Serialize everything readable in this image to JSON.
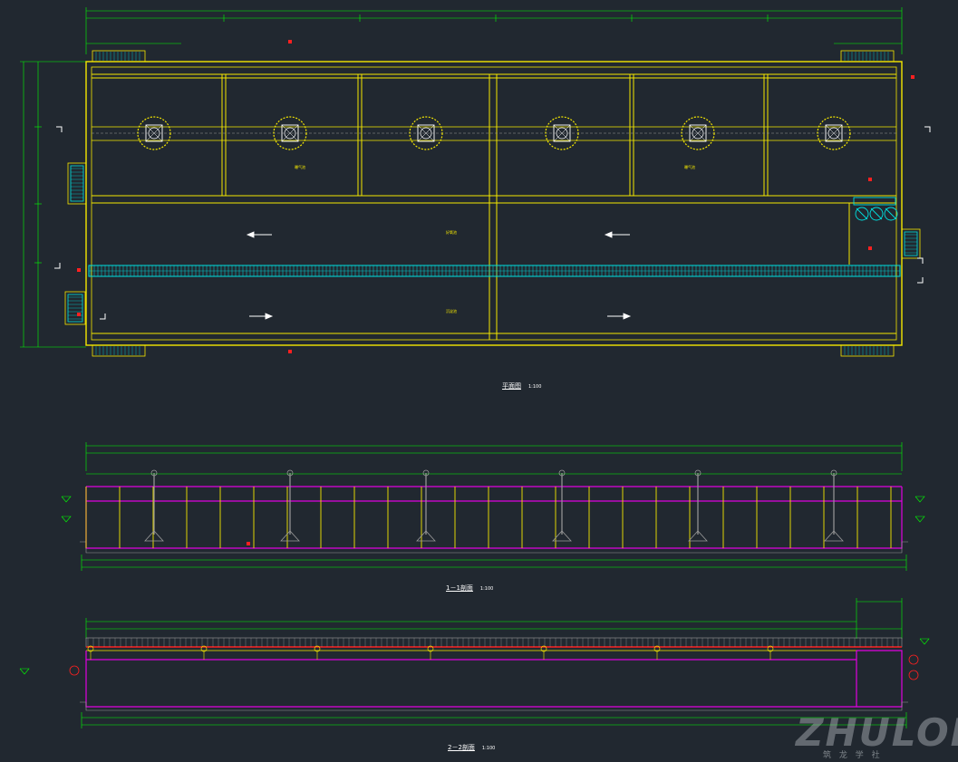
{
  "colors": {
    "background": "#212830",
    "yellow": "#f5e800",
    "green": "#00ff00",
    "cyan": "#00e0e0",
    "white": "#ffffff",
    "magenta": "#e000e0",
    "red": "#ff2020",
    "grey": "#9a9a9a"
  },
  "captions": {
    "plan": {
      "title": "平面图",
      "scale": "1:100"
    },
    "section1": {
      "title": "1－1剖面",
      "scale": "1:100"
    },
    "section2": {
      "title": "2－2剖面",
      "scale": "1:100"
    }
  },
  "plan": {
    "zone_labels": [
      "曝气池",
      "缺氧池",
      "好氧池",
      "沉淀池"
    ],
    "tank_count": 6
  },
  "watermark": {
    "logo_text": "ZHULONG",
    "sub_text": "筑 龙 学 社"
  }
}
